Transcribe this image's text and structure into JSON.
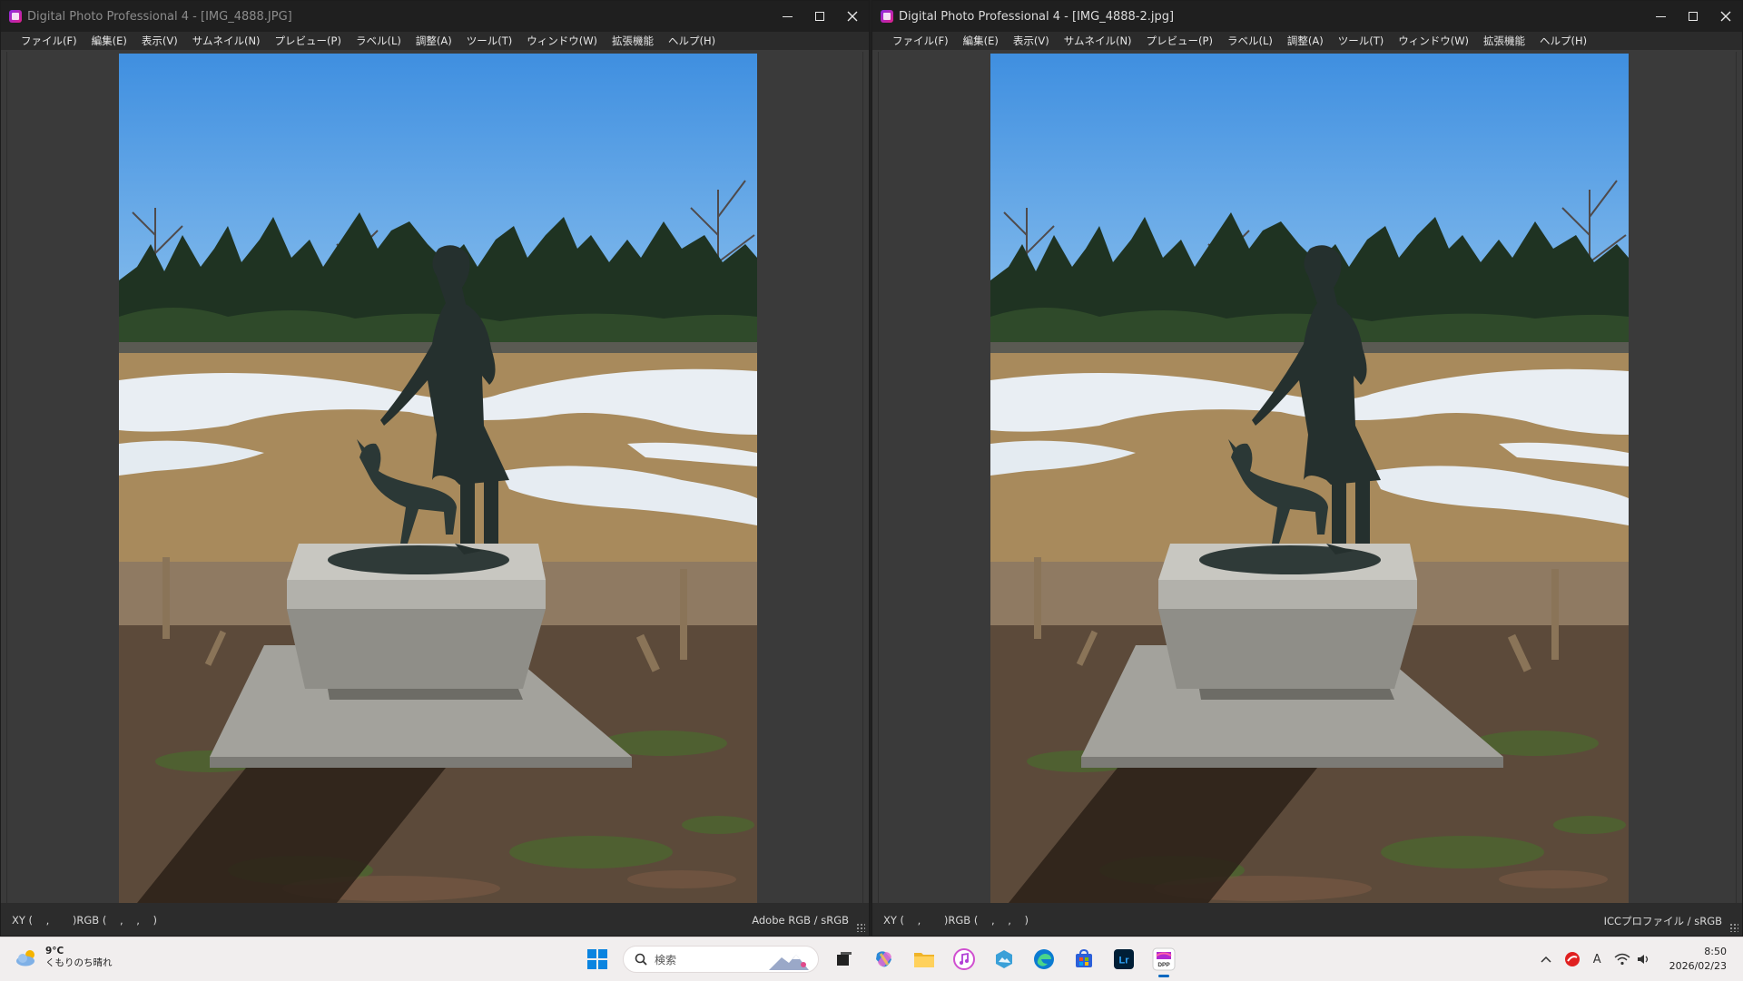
{
  "windows": [
    {
      "title": "Digital Photo Professional 4 - [IMG_4888.JPG]",
      "menu": [
        "ファイル(F)",
        "編集(E)",
        "表示(V)",
        "サムネイル(N)",
        "プレビュー(P)",
        "ラベル(L)",
        "調整(A)",
        "ツール(T)",
        "ウィンドウ(W)",
        "拡張機能",
        "ヘルプ(H)"
      ],
      "status_readout": "XY (    ,       )RGB (    ,    ,    )",
      "color_profile": "Adobe RGB / sRGB"
    },
    {
      "title": "Digital Photo Professional 4 - [IMG_4888-2.jpg]",
      "menu": [
        "ファイル(F)",
        "編集(E)",
        "表示(V)",
        "サムネイル(N)",
        "プレビュー(P)",
        "ラベル(L)",
        "調整(A)",
        "ツール(T)",
        "ウィンドウ(W)",
        "拡張機能",
        "ヘルプ(H)"
      ],
      "status_readout": "XY (    ,       )RGB (    ,    ,    )",
      "color_profile": "ICCプロファイル / sRGB"
    }
  ],
  "taskbar": {
    "weather_temp": "9°C",
    "weather_desc": "くもりのち晴れ",
    "search_placeholder": "検索",
    "pinned_icons": [
      "start-icon",
      "search-box",
      "task-view-icon",
      "copilot-icon",
      "file-explorer-icon",
      "itunes-icon",
      "photos-icon",
      "edge-icon",
      "store-icon",
      "lightroom-icon",
      "dpp-icon"
    ],
    "lightroom_label": "Lr",
    "dpp_label": "DPP",
    "ime_label": "A",
    "time": "8:50",
    "date": "2026/02/23"
  },
  "colors": {
    "title_bg": "#1f1f1f",
    "menu_bg": "#2b2b2b",
    "viewer_bg": "#3a3a3a",
    "taskbar_bg": "#f1eeee",
    "accent": "#0067c0"
  }
}
